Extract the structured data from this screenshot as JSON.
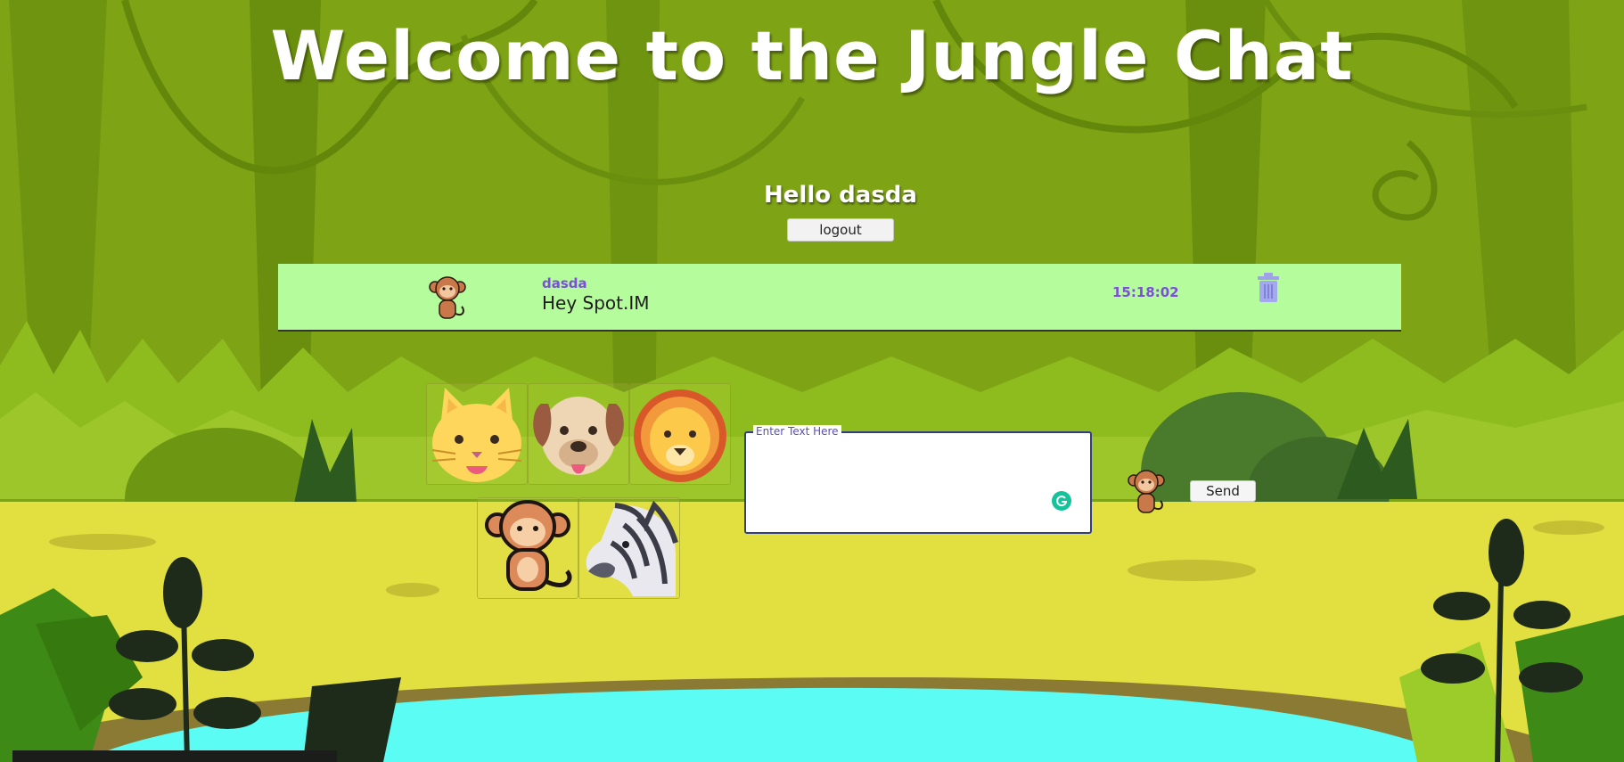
{
  "header": {
    "title": "Welcome to the Jungle Chat"
  },
  "user": {
    "greeting": "Hello dasda",
    "logout_label": "logout"
  },
  "messages": [
    {
      "username": "dasda",
      "text": "Hey Spot.IM",
      "time": "15:18:02",
      "avatar_icon": "monkey-icon",
      "delete_icon": "trash-icon"
    }
  ],
  "avatar_picker": {
    "options": [
      "cat-icon",
      "dog-icon",
      "lion-icon",
      "monkey-icon",
      "zebra-icon"
    ]
  },
  "compose": {
    "field_label": "Enter Text Here",
    "value": "",
    "send_label": "Send",
    "selected_avatar": "monkey-icon",
    "grammar_icon": "grammarly-icon"
  },
  "colors": {
    "message_bg": "#b4fc9c",
    "username": "#7b4fd8",
    "water": "#5afcf4",
    "ground": "#e2df40"
  }
}
